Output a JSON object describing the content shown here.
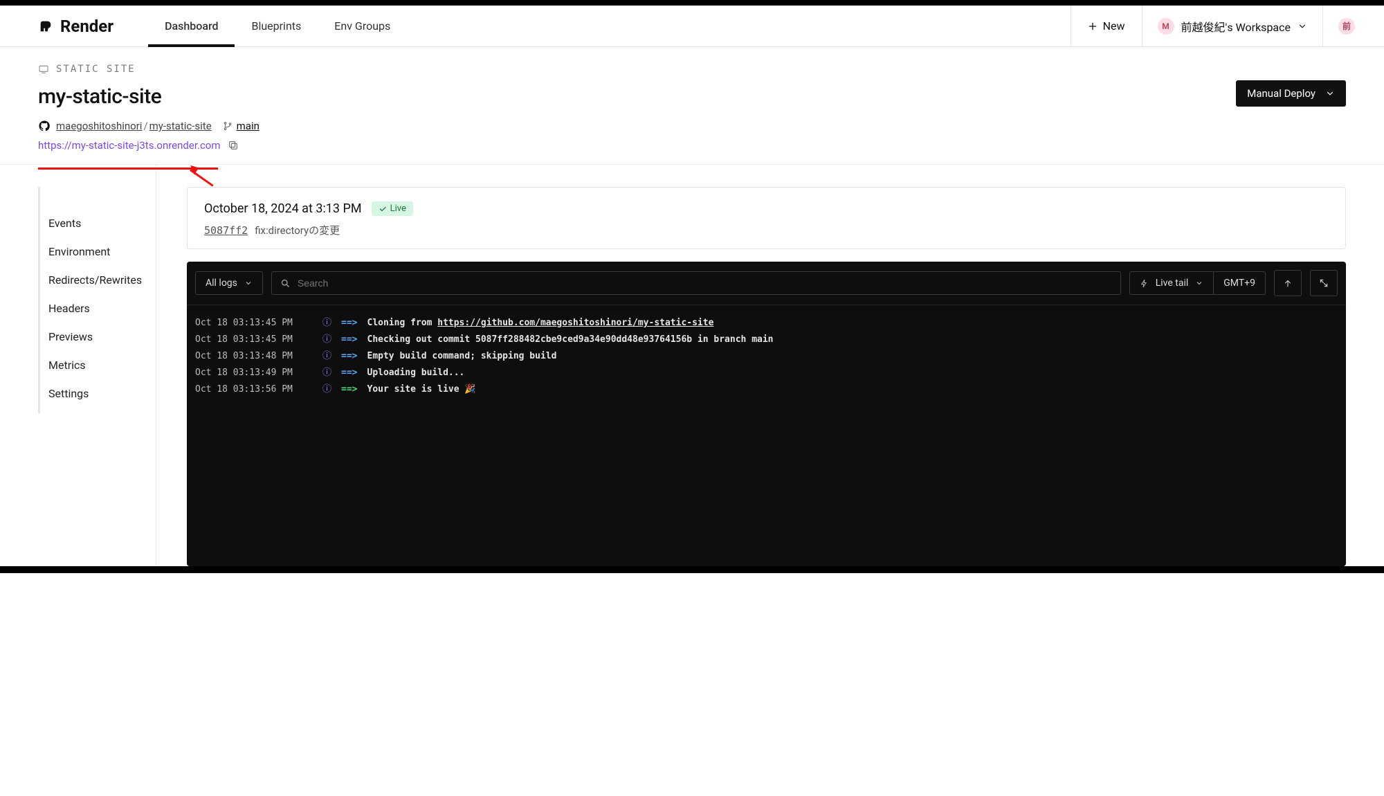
{
  "brand": "Render",
  "nav": [
    {
      "label": "Dashboard",
      "active": true
    },
    {
      "label": "Blueprints",
      "active": false
    },
    {
      "label": "Env Groups",
      "active": false
    }
  ],
  "new_label": "New",
  "workspace": {
    "initial": "M",
    "label": "前越俊紀's Workspace"
  },
  "avatar_initial": "前",
  "page": {
    "type_label": "STATIC SITE",
    "title": "my-static-site",
    "deploy_button": "Manual Deploy",
    "repo": {
      "owner": "maegoshitoshinori",
      "name": "my-static-site"
    },
    "branch": "main",
    "url": "https://my-static-site-j3ts.onrender.com"
  },
  "sidebar": [
    "Events",
    "Environment",
    "Redirects/Rewrites",
    "Headers",
    "Previews",
    "Metrics",
    "Settings"
  ],
  "deploy_card": {
    "date": "October 18, 2024 at 3:13 PM",
    "live_label": "Live",
    "commit_hash": "5087ff2",
    "commit_msg": "fix:directoryの変更"
  },
  "log_toolbar": {
    "all_logs": "All logs",
    "search_placeholder": "Search",
    "live_tail": "Live tail",
    "tz": "GMT+9"
  },
  "logs": [
    {
      "time": "Oct 18 03:13:45 PM",
      "arrow_class": "",
      "text_prefix": "Cloning from ",
      "text_url": "https://github.com/maegoshitoshinori/my-static-site",
      "text_suffix": ""
    },
    {
      "time": "Oct 18 03:13:45 PM",
      "arrow_class": "",
      "text": "Checking out commit 5087ff288482cbe9ced9a34e90dd48e93764156b in branch main"
    },
    {
      "time": "Oct 18 03:13:48 PM",
      "arrow_class": "",
      "text": "Empty build command; skipping build"
    },
    {
      "time": "Oct 18 03:13:49 PM",
      "arrow_class": "",
      "text": "Uploading build..."
    },
    {
      "time": "Oct 18 03:13:56 PM",
      "arrow_class": "green",
      "text": "Your site is live 🎉"
    }
  ]
}
